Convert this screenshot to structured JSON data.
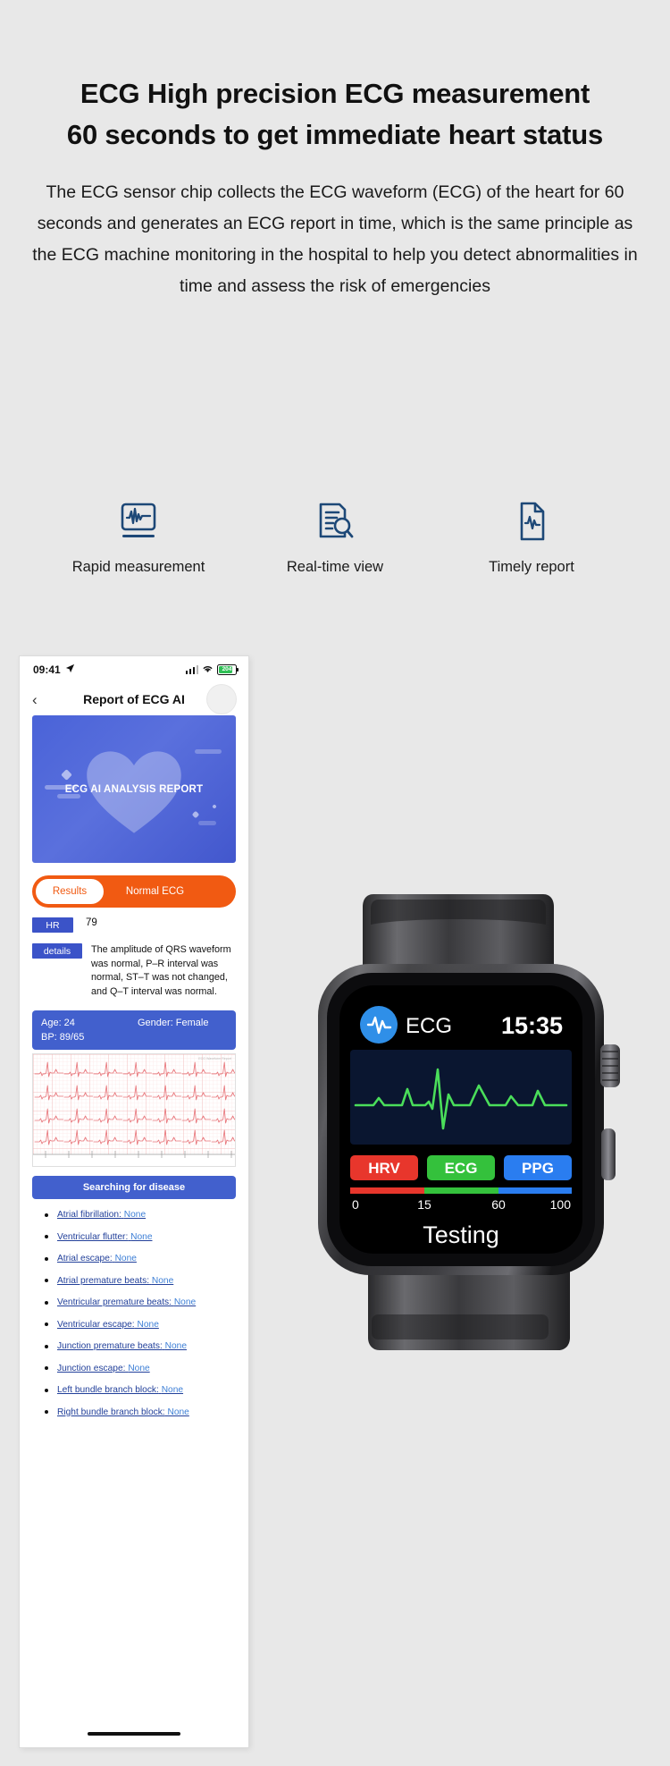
{
  "hero_section": {
    "headline_line1": "ECG High precision ECG measurement",
    "headline_line2": "60 seconds to get immediate heart status",
    "paragraph": "The ECG sensor chip collects the ECG waveform (ECG) of the heart for 60 seconds and generates an ECG report in time, which is the same principle as the ECG machine monitoring in the hospital to help you detect abnormalities in time and assess the risk of emergencies"
  },
  "features": [
    {
      "icon": "waveform-monitor-icon",
      "label": "Rapid measurement"
    },
    {
      "icon": "document-search-icon",
      "label": "Real-time view"
    },
    {
      "icon": "report-pulse-icon",
      "label": "Timely report"
    }
  ],
  "phone": {
    "status_bar": {
      "time": "09:41",
      "location_icon": "location-arrow-icon",
      "signal_icon": "cellular-bars-icon",
      "wifi_icon": "wifi-icon",
      "battery_level": "204"
    },
    "nav": {
      "back_icon": "chevron-left-icon",
      "title": "Report of ECG AI"
    },
    "banner": {
      "title": "ECG AI ANALYSIS REPORT",
      "heart_icon": "heart-icon"
    },
    "results": {
      "tag_label": "Results",
      "value": "Normal ECG"
    },
    "hr": {
      "label": "HR",
      "value": "79"
    },
    "details": {
      "label": "details",
      "text": "The amplitude of QRS waveform was normal, P–R interval was normal, ST–T was not changed, and Q–T interval was normal."
    },
    "info": {
      "age": "Age: 24",
      "gender": "Gender: Female",
      "bp": "BP: 89/65"
    },
    "chart_caption": "ECG Waveform Report",
    "search_button": "Searching for disease",
    "diseases": [
      {
        "name": "Atrial fibrillation:",
        "result": "None"
      },
      {
        "name": "Ventricular flutter:",
        "result": "None"
      },
      {
        "name": "Atrial escape:",
        "result": "None"
      },
      {
        "name": "Atrial premature beats:",
        "result": "None"
      },
      {
        "name": "Ventricular premature beats:",
        "result": "None"
      },
      {
        "name": "Ventricular escape:",
        "result": "None"
      },
      {
        "name": "Junction premature beats:",
        "result": "None"
      },
      {
        "name": "Junction escape:",
        "result": "None"
      },
      {
        "name": "Left bundle branch block:",
        "result": "None"
      },
      {
        "name": "Right bundle branch block:",
        "result": "None"
      }
    ]
  },
  "watch": {
    "app_icon": "ecg-pulse-icon",
    "app_label": "ECG",
    "time": "15:35",
    "modes": [
      {
        "label": "HRV",
        "color": "#e8362c"
      },
      {
        "label": "ECG",
        "color": "#34c13c"
      },
      {
        "label": "PPG",
        "color": "#2a7df0"
      }
    ],
    "scale_ticks": [
      "0",
      "15",
      "60",
      "100"
    ],
    "status": "Testing"
  },
  "colors": {
    "page_bg": "#e8e8e8",
    "brand_blue": "#4260cd",
    "chip_blue": "#3b53c8",
    "accent_orange": "#f15a12",
    "link_blue": "#22409a",
    "value_blue": "#3d7fd6",
    "icon_navy": "#1d4877",
    "watch_green": "#4ade5a"
  }
}
